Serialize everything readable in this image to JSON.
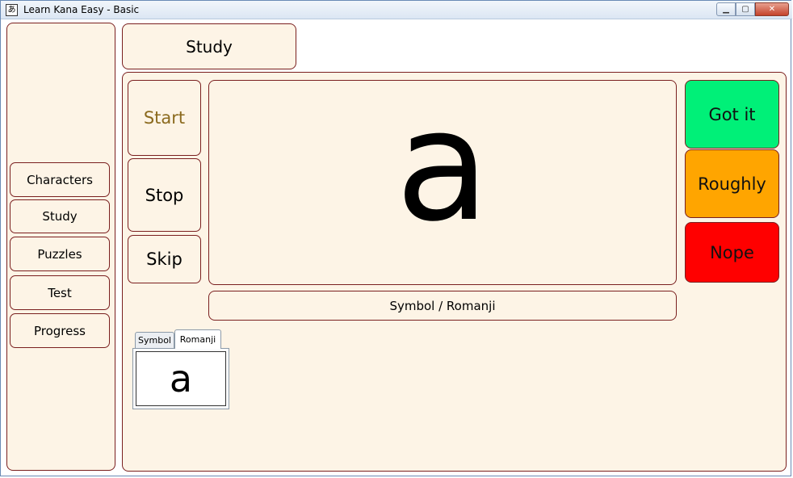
{
  "window": {
    "title": "Learn Kana Easy - Basic",
    "icon_glyph": "あ",
    "controls": {
      "minimize": "▁",
      "maximize": "▢",
      "close": "✕"
    }
  },
  "header": {
    "section_title": "Study"
  },
  "sidebar": {
    "items": [
      {
        "label": "Characters"
      },
      {
        "label": "Study"
      },
      {
        "label": "Puzzles"
      },
      {
        "label": "Test"
      },
      {
        "label": "Progress"
      }
    ]
  },
  "controls": {
    "start_label": "Start",
    "stop_label": "Stop",
    "skip_label": "Skip"
  },
  "card": {
    "symbol": "a",
    "mode_label": "Symbol / Romanji"
  },
  "rating": {
    "got_it_label": "Got it",
    "roughly_label": "Roughly",
    "nope_label": "Nope",
    "got_it_color": "#00f078",
    "roughly_color": "#ffa500",
    "nope_color": "#ff0000"
  },
  "preview": {
    "tabs": [
      {
        "label": "Symbol"
      },
      {
        "label": "Romanji"
      }
    ],
    "active_tab": "Romanji",
    "value": "a"
  },
  "colors": {
    "panel_bg": "#fdf4e6",
    "panel_border": "#7a1f1f",
    "start_text": "#8b6a1e"
  }
}
